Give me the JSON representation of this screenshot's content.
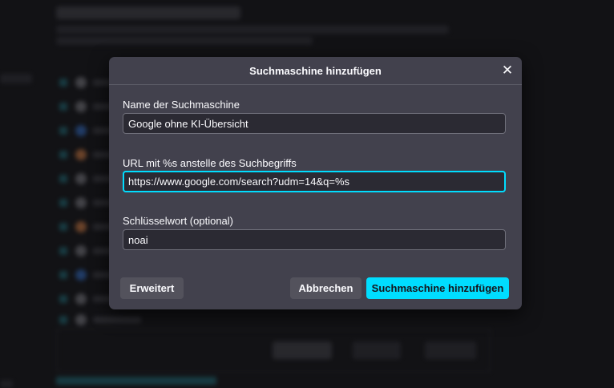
{
  "dialog": {
    "title": "Suchmaschine hinzufügen",
    "close_icon": "close-icon",
    "fields": {
      "name": {
        "label": "Name der Suchmaschine",
        "value": "Google ohne KI-Übersicht"
      },
      "url": {
        "label": "URL mit %s anstelle des Suchbegriffs",
        "value": "https://www.google.com/search?udm=14&q=%s"
      },
      "keyword": {
        "label": "Schlüsselwort (optional)",
        "value": "noai"
      }
    },
    "buttons": {
      "advanced": "Erweitert",
      "cancel": "Abbrechen",
      "add": "Suchmaschine hinzufügen"
    }
  },
  "colors": {
    "dialog_bg": "#42414d",
    "input_bg": "#2b2a33",
    "accent": "#00ddff",
    "page_bg": "#121215"
  }
}
